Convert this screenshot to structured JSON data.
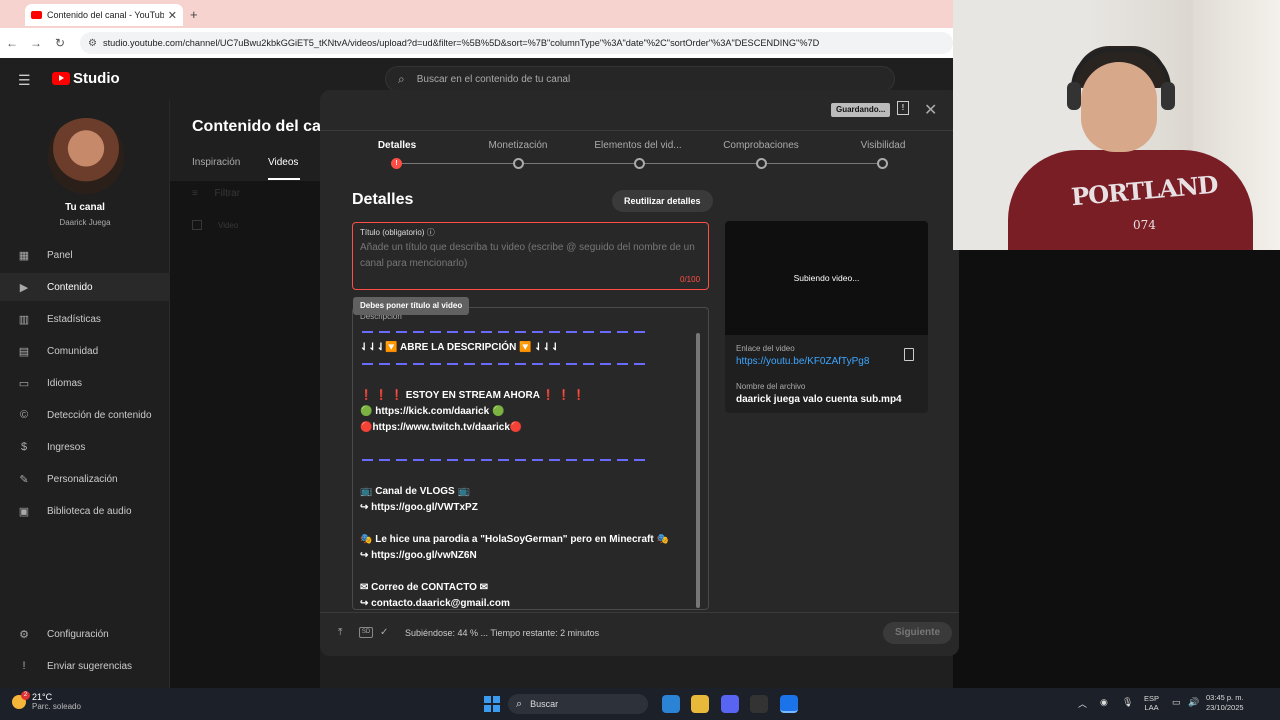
{
  "browser": {
    "tab_title": "Contenido del canal - YouTube",
    "tab_close": "✕",
    "new_tab": "+",
    "url": "studio.youtube.com/channel/UC7uBwu2kbkGGiET5_tKNtvA/videos/upload?d=ud&filter=%5B%5D&sort=%7B\"columnType\"%3A\"date\"%2C\"sortOrder\"%3A\"DESCENDING\"%7D"
  },
  "header": {
    "logo_text": "Studio",
    "search_placeholder": "Buscar en el contenido de tu canal"
  },
  "sidebar": {
    "channel_title": "Tu canal",
    "channel_name": "Daarick Juega",
    "items": [
      {
        "label": "Panel",
        "icon": "▦"
      },
      {
        "label": "Contenido",
        "icon": "▶"
      },
      {
        "label": "Estadísticas",
        "icon": "▥"
      },
      {
        "label": "Comunidad",
        "icon": "▤"
      },
      {
        "label": "Idiomas",
        "icon": "▭"
      },
      {
        "label": "Detección de contenido",
        "icon": "©"
      },
      {
        "label": "Ingresos",
        "icon": "$"
      },
      {
        "label": "Personalización",
        "icon": "✎"
      },
      {
        "label": "Biblioteca de audio",
        "icon": "▣"
      }
    ],
    "settings": "Configuración",
    "feedback": "Enviar sugerencias"
  },
  "content": {
    "title": "Contenido del canal",
    "tabs": [
      "Inspiración",
      "Videos"
    ],
    "filter": "Filtrar",
    "video_col": "Video"
  },
  "modal": {
    "saving_badge": "Guardando...",
    "steps": [
      "Detalles",
      "Monetización",
      "Elementos del vid...",
      "Comprobaciones",
      "Visibilidad"
    ],
    "heading": "Detalles",
    "reuse_button": "Reutilizar detalles",
    "title_label": "Título (obligatorio)",
    "title_placeholder": "Añade un título que describa tu video (escribe @ seguido del nombre de un canal para mencionarlo)",
    "title_count": "0/100",
    "tooltip": "Debes poner título al video",
    "desc_label": "Descripción",
    "desc_lines": [
      "⇃⇃⇃🔽 ABRE LA DESCRIPCIÓN 🔽 ⇃⇃⇃",
      "❗ ❗ ❗ ESTOY EN STREAM AHORA ❗ ❗ ❗",
      "🟢 https://kick.com/daarick 🟢",
      "🔴https://www.twitch.tv/daarick🔴",
      "📺 Canal de VLOGS 📺",
      "↪ https://goo.gl/VWTxPZ",
      "🎭 Le hice una parodia a \"HolaSoyGerman\" pero en Minecraft 🎭",
      "↪ https://goo.gl/vwNZ6N",
      "✉ Correo de CONTACTO ✉",
      "↪ contacto.daarick@gmail.com"
    ],
    "preview_status": "Subiendo video...",
    "link_label": "Enlace del video",
    "link": "https://youtu.be/KF0ZAfTyPg8",
    "file_label": "Nombre del archivo",
    "file_name": "daarick juega valo cuenta sub.mp4",
    "sd_badge": "SD",
    "upload_status": "Subiéndose: 44 % ... Tiempo restante: 2 minutos",
    "upload_progress_percent": 44,
    "next_button": "Siguiente"
  },
  "webcam": {
    "shirt_text": "PORTLAND",
    "shirt_number": "074"
  },
  "taskbar": {
    "temp": "21°C",
    "weather": "Parc. soleado",
    "search": "Buscar",
    "lang1": "ESP",
    "lang2": "LAA",
    "time": "03:45 p. m.",
    "date": "23/10/2025"
  }
}
